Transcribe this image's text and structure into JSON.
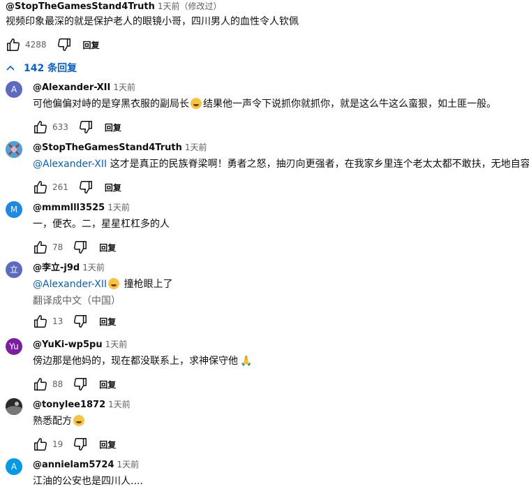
{
  "top_comment": {
    "author": "@StopTheGamesStand4Truth",
    "meta": "1天前（修改过）",
    "text": "视频印象最深的就是保护老人的眼镜小哥，四川男人的血性令人钦佩",
    "likes": "4288",
    "reply_label": "回复"
  },
  "replies_toggle": {
    "label": "142 条回复"
  },
  "replies": [
    {
      "avatar_letter": "A",
      "avatar_color": "#5c6bc0",
      "author": "@Alexander-XII",
      "meta": "1天前",
      "text_before": "可他偏偏对峙的是穿黑衣服的副局长",
      "text_after": "结果他一声令下说抓你就抓你，就是这么牛这么蛮狠，如土匪一般。",
      "likes": "633",
      "reply_label": "回复"
    },
    {
      "avatar_letter": "",
      "avatar_color": "#4aa3d8",
      "author": "@StopTheGamesStand4Truth",
      "meta": "1天前",
      "mention": "@Alexander-XII",
      "text": " 这才是真正的民族脊梁啊！勇者之怒，抽刃向更强者，在我家乡里连个老太太都不敢扶，无地自容",
      "likes": "261",
      "reply_label": "回复"
    },
    {
      "avatar_letter": "M",
      "avatar_color": "#1e88e5",
      "author": "@mmmlll3525",
      "meta": "1天前",
      "text": "一，便衣。二，星星杠杠多的人",
      "likes": "78",
      "reply_label": "回复"
    },
    {
      "avatar_letter": "立",
      "avatar_color": "#5c6bc0",
      "author": "@李立-j9d",
      "meta": "1天前",
      "mention": "@Alexander-XII",
      "text": " 撞枪眼上了",
      "translate": "翻译成中文（中国）",
      "likes": "13",
      "reply_label": "回复"
    },
    {
      "avatar_letter": "Yu",
      "avatar_color": "#7b1fa2",
      "author": "@YuKi-wp5pu",
      "meta": "1天前",
      "text": "傍边那是他妈的，现在都没联系上，求神保守他",
      "likes": "88",
      "reply_label": "回复"
    },
    {
      "avatar_letter": "",
      "avatar_color": "#333333",
      "author": "@tonylee1872",
      "meta": "1天前",
      "text": "熟悉配方",
      "likes": "19",
      "reply_label": "回复"
    },
    {
      "avatar_letter": "A",
      "avatar_color": "#039be5",
      "author": "@annielam5724",
      "meta": "1天前",
      "text": "江油的公安也是四川人....",
      "likes": "",
      "reply_label": ""
    }
  ]
}
